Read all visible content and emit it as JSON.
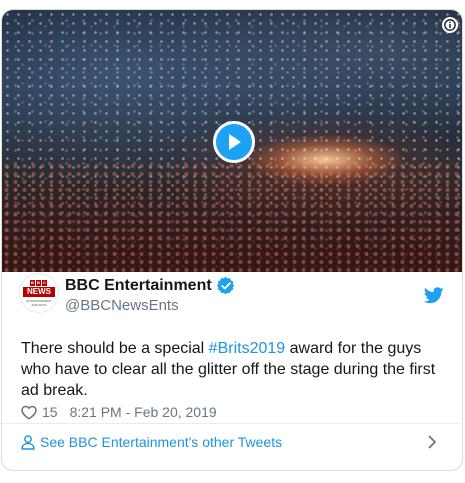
{
  "tweet": {
    "author_name": "BBC Entertainment",
    "verified": true,
    "handle": "@BBCNewsEnts",
    "text_before": "There should be a special ",
    "hashtag": "#Brits2019",
    "text_after": " award for the guys who have to clear all the glitter off the stage during the first ad break.",
    "likes": "15",
    "timestamp": "8:21 PM - Feb 20, 2019"
  },
  "avatar": {
    "letters": [
      "B",
      "B",
      "C"
    ],
    "word": "NEWS",
    "sub": "ENTERTAINMENT AND ARTS"
  },
  "footer": {
    "see_more_label": "See BBC Entertainment's other Tweets"
  },
  "icons": {
    "play": "play-icon",
    "info": "info-icon",
    "verified": "verified-badge-icon",
    "bird": "twitter-bird-icon",
    "heart": "heart-icon",
    "user": "user-icon",
    "chevron": "chevron-right-icon"
  },
  "colors": {
    "accent": "#1da1f2",
    "link": "#1b95e0",
    "text": "#14171a",
    "muted": "#657786",
    "bbc_red": "#b80000"
  }
}
